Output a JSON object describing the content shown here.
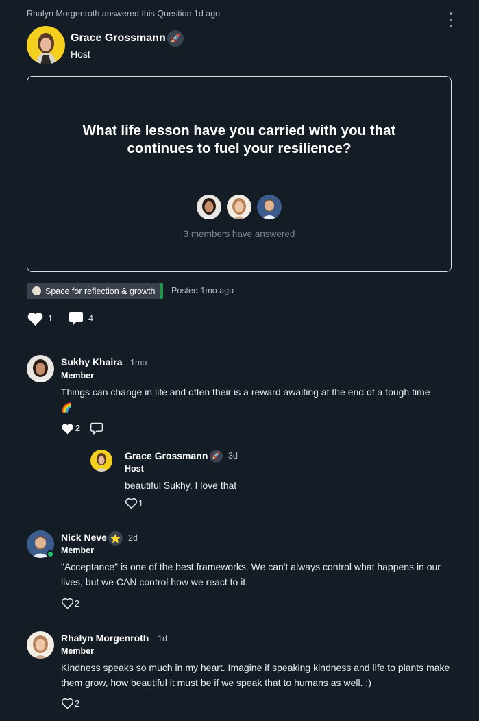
{
  "activity": "Rhalyn Morgenroth answered this Question 1d ago",
  "host": {
    "name": "Grace Grossmann",
    "role": "Host",
    "badge": "🚀"
  },
  "question": {
    "text": "What life lesson have you carried with you that continues to fuel your resilience?",
    "answered_text": "3 members have answered"
  },
  "space": {
    "name": "Space for reflection & growth",
    "accent": "#1e9b4a"
  },
  "posted": "Posted 1mo ago",
  "post_reactions": {
    "likes": "1",
    "comments": "4"
  },
  "comments": [
    {
      "name": "Sukhy Khaira",
      "time": "1mo",
      "role": "Member",
      "text": "Things can change in life and often their is a reward awaiting at the end of a tough time",
      "emoji": "🌈",
      "likes": "2"
    },
    {
      "name": "Nick Neve",
      "badge": "⭐",
      "time": "2d",
      "role": "Member",
      "text": "\"Acceptance\" is one of the best frameworks. We can't always control what happens in our lives, but we CAN control how we react to it.",
      "likes": "2"
    },
    {
      "name": "Rhalyn Morgenroth",
      "time": "1d",
      "role": "Member",
      "text": "Kindness speaks so much in my heart. Imagine if speaking kindness and life to plants make them grow, how beautiful it must be if we speak that to humans as well. :)",
      "likes": "2"
    }
  ],
  "reply": {
    "name": "Grace Grossmann",
    "badge": "🚀",
    "time": "3d",
    "role": "Host",
    "text": "beautiful Sukhy, I love that",
    "likes": "1"
  },
  "colors": {
    "background": "#141c26",
    "host_avatar_bg": "#f5cf1e",
    "online": "#24c26b"
  }
}
